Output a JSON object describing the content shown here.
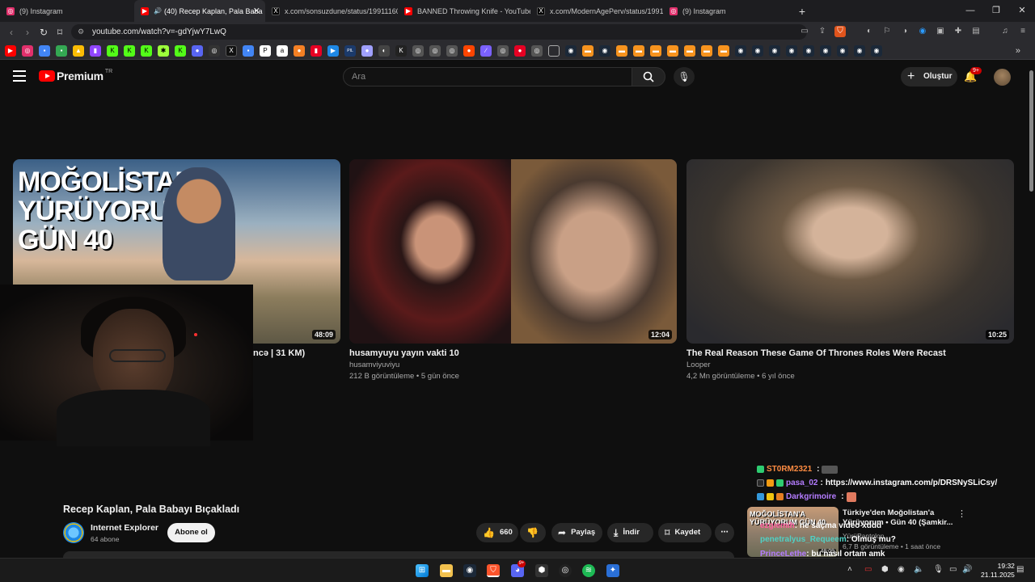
{
  "browser": {
    "tabs": [
      {
        "title": "(9) Instagram",
        "icon": "instagram-icon",
        "color": "#e1306c"
      },
      {
        "title": "(40) Recep Kaplan, Pala Baba",
        "icon": "youtube-icon",
        "color": "#ff0000",
        "active": true
      },
      {
        "title": "x.com/sonsuzdune/status/19911160",
        "icon": "x-icon",
        "color": "#000000"
      },
      {
        "title": "BANNED Throwing Knife - YouTube",
        "icon": "youtube-icon",
        "color": "#ff0000"
      },
      {
        "title": "x.com/ModernAgePerv/status/19918",
        "icon": "x-icon",
        "color": "#000000"
      },
      {
        "title": "(9) Instagram",
        "icon": "instagram-icon",
        "color": "#e1306c"
      }
    ],
    "url": "youtube.com/watch?v=-gdYjwY7LwQ",
    "shield_count": "6"
  },
  "youtube": {
    "logo_text": "Premium",
    "region": "TR",
    "search_placeholder": "Ara",
    "create_label": "Oluştur",
    "notif_badge": "9+"
  },
  "videos": [
    {
      "title": "ncə | 31 KM)",
      "thumb_text": "MOĞOLİSTAN'A YÜRÜYORUM GÜN 40",
      "duration": "48:09"
    },
    {
      "title": "husamyuyu yayın vakti 10",
      "channel": "husamviyuviyu",
      "meta": "212 B görüntüleme • 5 gün önce",
      "duration": "12:04"
    },
    {
      "title": "The Real Reason These Game Of Thrones Roles Were Recast",
      "channel": "Looper",
      "meta": "4,2 Mn görüntüleme • 6 yıl önce",
      "duration": "10:25"
    }
  ],
  "chat": [
    {
      "name": "ST0RM2321",
      "color": "#ff8c42",
      "msg": ""
    },
    {
      "name": "pasa_02",
      "color": "#b47cff",
      "msg": "https://www.instagram.com/p/DRSNySLiCsy/"
    },
    {
      "name": "Darkgrimoire",
      "color": "#b47cff",
      "msg": ""
    }
  ],
  "chat_overlay": [
    {
      "name": "ezgiemih",
      "msg": ": ne saçma video xddd",
      "color": "#ff5fa2"
    },
    {
      "name": "penetralyus_Requeem",
      "msg": ": Olmuş mu?",
      "color": "#4fd1c5"
    },
    {
      "name": "PrinceLethe",
      "msg": ": bu nasıl ortam amk",
      "color": "#b47cff"
    }
  ],
  "watch": {
    "title": "Recep Kaplan, Pala Babayı Bıçakladı",
    "channel": "Internet Explorer",
    "subs": "64 abone",
    "subscribe_label": "Abone ol",
    "likes": "660",
    "share_label": "Paylaş",
    "download_label": "İndir",
    "save_label": "Kaydet"
  },
  "related": {
    "title": "Türkiye'den Moğolistan'a Yürüyorum • Gün 40 (Şamkir...",
    "channel": "YürüPantolon",
    "meta": "6,7 B görüntüleme • 1 saat önce",
    "thumb_text": "MOĞOLİSTAN'A YÜRÜYORUM GÜN 40",
    "duration": "48:09"
  },
  "taskbar": {
    "time": "19:32",
    "date": "21.11.2025",
    "discord_badge": "9+"
  }
}
